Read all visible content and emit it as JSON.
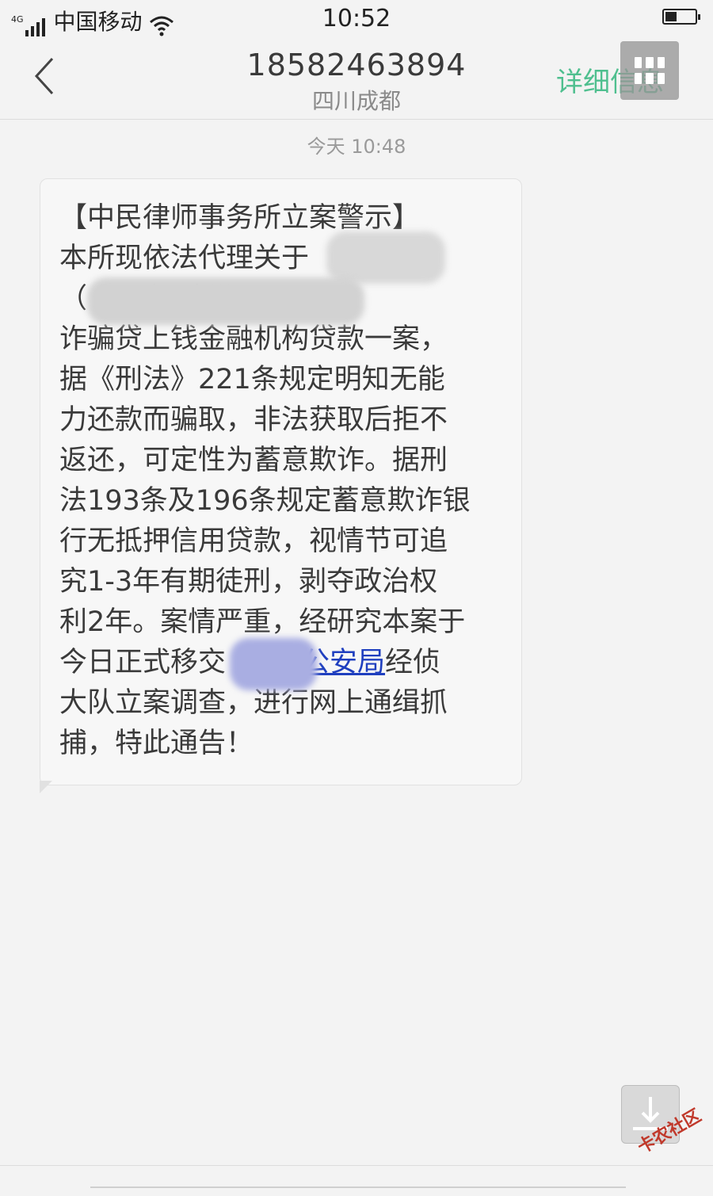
{
  "status_bar": {
    "network": "4G",
    "carrier": "中国移动",
    "time": "10:52"
  },
  "header": {
    "title": "18582463894",
    "subtitle": "四川成都",
    "details": "详细信息"
  },
  "timestamp": "今天 10:48",
  "message": {
    "lines": [
      "【中民律师事务所立案警示】",
      "本所现依法代理关于",
      "（                         ****）涉嫌",
      "诈骗贷上钱金融机构贷款一案，",
      "据《刑法》221条规定明知无能",
      "力还款而骗取，非法获取后拒不",
      "返还，可定性为蓄意欺诈。据刑",
      "法193条及196条规定蓄意欺诈银",
      "行无抵押信用贷款，视情节可追",
      "究1-3年有期徒刑，剥夺政治权",
      "利2年。案情严重，经研究本案于"
    ],
    "line12_before": "今日正式移交",
    "line12_link": "公安局",
    "line12_after": "经侦",
    "lines_after": [
      "大队立案调查，进行网上通缉抓",
      "捕，特此通告！"
    ]
  },
  "watermark": "卡农社区",
  "colors": {
    "background": "#f3f3f3",
    "accent_green": "#4fbf8f",
    "link_blue": "#1f3fbf"
  }
}
